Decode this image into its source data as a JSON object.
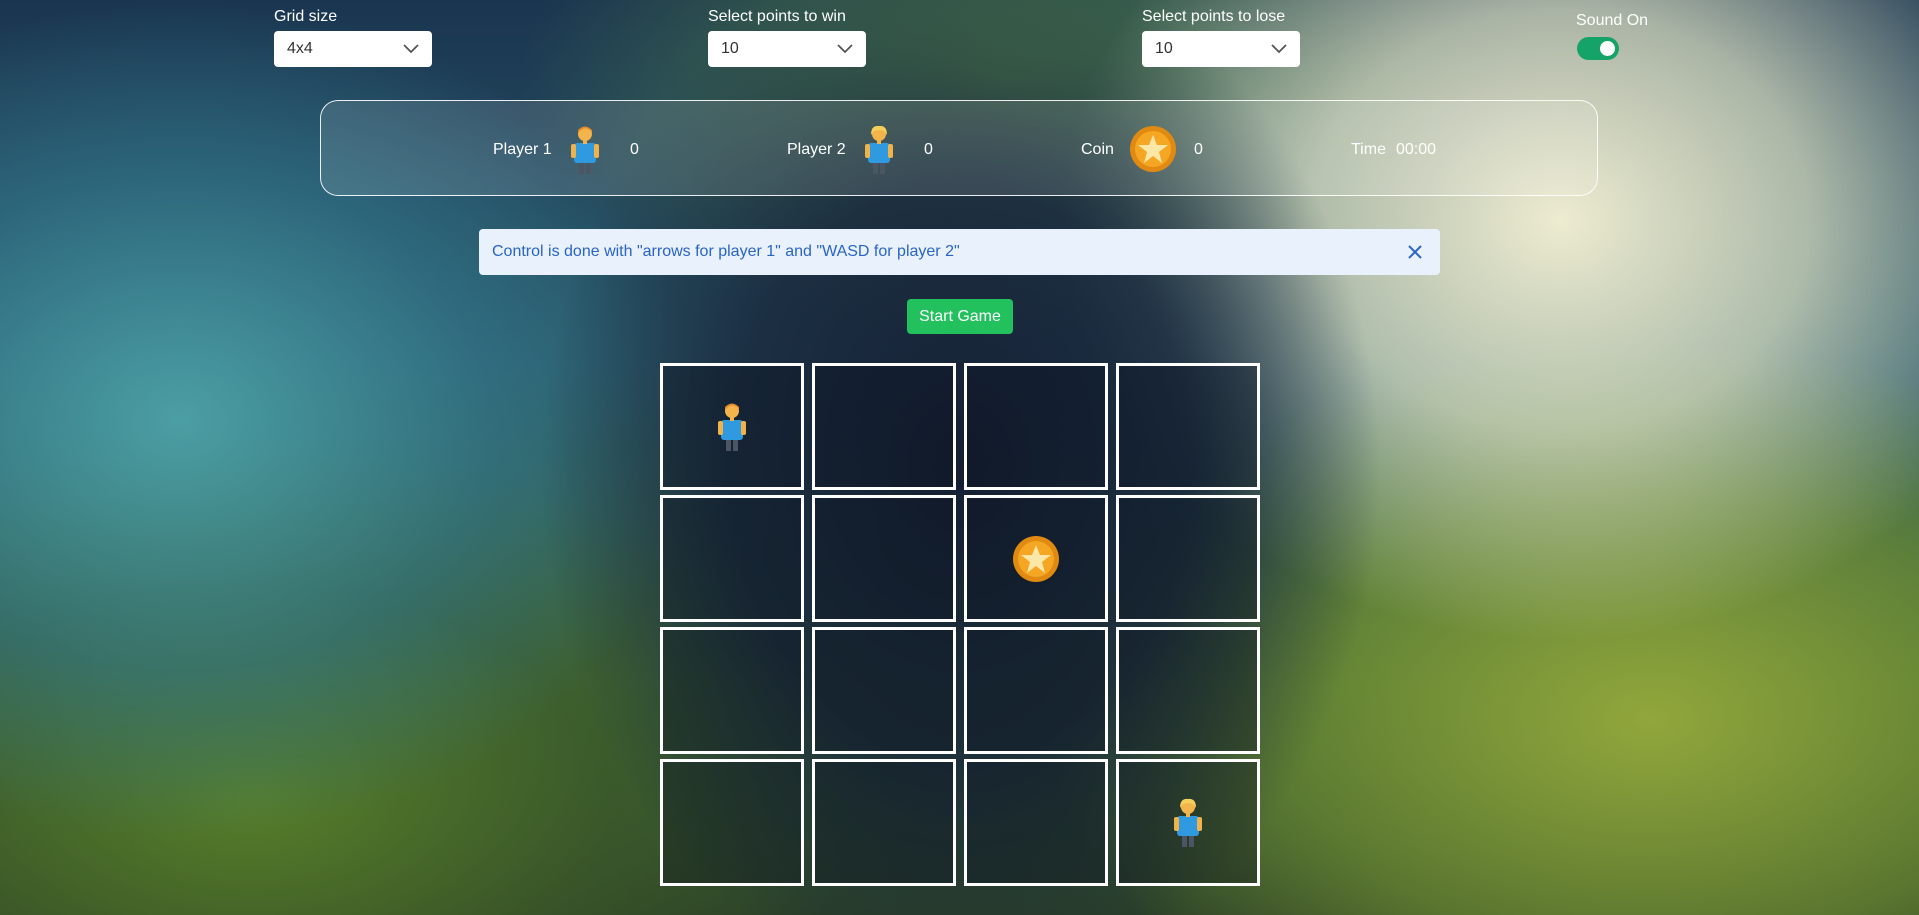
{
  "settings": {
    "grid_size": {
      "label": "Grid size",
      "value": "4x4"
    },
    "points_win": {
      "label": "Select points to win",
      "value": "10"
    },
    "points_lose": {
      "label": "Select points to lose",
      "value": "10"
    },
    "sound": {
      "label": "Sound On",
      "on": true
    }
  },
  "scoreboard": {
    "player1": {
      "label": "Player 1",
      "score": "0",
      "icon": "player-boy-icon"
    },
    "player2": {
      "label": "Player 2",
      "score": "0",
      "icon": "player-blonde-icon"
    },
    "coin": {
      "label": "Coin",
      "score": "0",
      "icon": "coin-star-icon"
    },
    "time": {
      "label": "Time",
      "value": "00:00"
    }
  },
  "alert": {
    "message": "Control is done with \"arrows for player 1\" and \"WASD for player 2\""
  },
  "start_button": {
    "label": "Start Game"
  },
  "board": {
    "rows": 4,
    "cols": 4,
    "pieces": [
      {
        "type": "player1",
        "row": 0,
        "col": 0
      },
      {
        "type": "coin",
        "row": 1,
        "col": 2
      },
      {
        "type": "player2",
        "row": 3,
        "col": 3
      }
    ]
  },
  "colors": {
    "toggle": "#16a36a",
    "start_button": "#22c15e",
    "alert_text": "#2a64c4",
    "alert_bg": "#e8f1fc"
  }
}
